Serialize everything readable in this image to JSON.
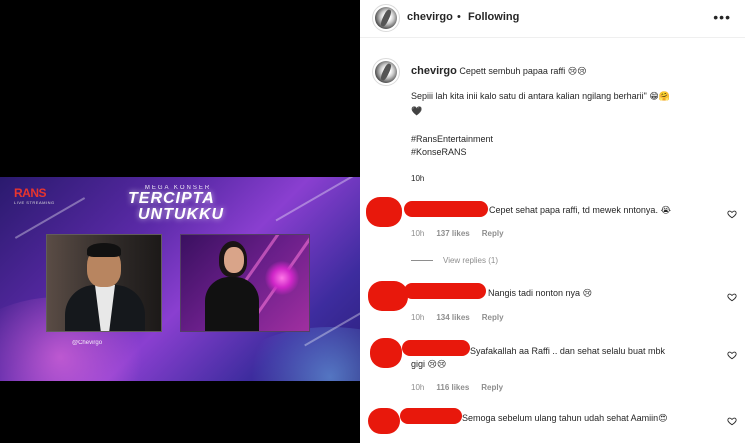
{
  "media": {
    "logo_main": "RANS",
    "logo_sub": "LIVE STREAMING",
    "title_small": "MEGA KONSER",
    "title_line1": "TERCIPTA",
    "title_line2": "UNTUKKU",
    "watermark": "@Chevirgo"
  },
  "header": {
    "username": "chevirgo",
    "separator": "•",
    "follow_status": "Following",
    "more_icon": "more-horizontal-icon"
  },
  "caption": {
    "username": "chevirgo",
    "line1": "Cepett sembuh papaa raffi 😢😢",
    "line2": "Sepiii lah kita inii kalo satu di antara kalian ngilang berharii\" 😁🤗",
    "line3": "🖤",
    "hashtag1": "#RansEntertainment",
    "hashtag2": "#KonseRANS",
    "time": "10h"
  },
  "comments": [
    {
      "text": "Cepet sehat papa raffi, td mewek nntonya. 😭",
      "time": "10h",
      "likes": "137 likes",
      "reply": "Reply",
      "view_replies": "View replies (1)"
    },
    {
      "text": "Nangis tadi nonton nya 😢",
      "time": "10h",
      "likes": "134 likes",
      "reply": "Reply"
    },
    {
      "text_line1": "Syafakallah aa Raffi .. dan sehat selalu buat mbk",
      "text_line2": "gigi 😢😢",
      "time": "10h",
      "likes": "116 likes",
      "reply": "Reply"
    },
    {
      "text": "Semoga sebelum ulang tahun udah sehat Aamiin😍"
    }
  ],
  "colors": {
    "redaction": "#e8180c",
    "link": "#00376b",
    "muted": "#8e8e8e"
  }
}
